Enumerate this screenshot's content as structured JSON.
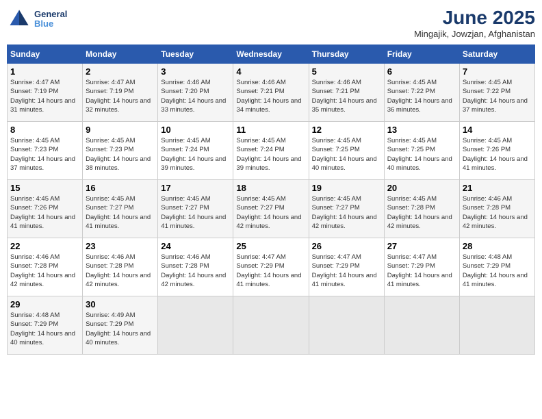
{
  "header": {
    "logo_line1": "General",
    "logo_line2": "Blue",
    "title": "June 2025",
    "subtitle": "Mingajik, Jowzjan, Afghanistan"
  },
  "calendar": {
    "days_of_week": [
      "Sunday",
      "Monday",
      "Tuesday",
      "Wednesday",
      "Thursday",
      "Friday",
      "Saturday"
    ],
    "weeks": [
      [
        null,
        {
          "day": "2",
          "sunrise": "4:47 AM",
          "sunset": "7:19 PM",
          "daylight": "14 hours and 32 minutes."
        },
        {
          "day": "3",
          "sunrise": "4:46 AM",
          "sunset": "7:20 PM",
          "daylight": "14 hours and 33 minutes."
        },
        {
          "day": "4",
          "sunrise": "4:46 AM",
          "sunset": "7:21 PM",
          "daylight": "14 hours and 34 minutes."
        },
        {
          "day": "5",
          "sunrise": "4:46 AM",
          "sunset": "7:21 PM",
          "daylight": "14 hours and 35 minutes."
        },
        {
          "day": "6",
          "sunrise": "4:45 AM",
          "sunset": "7:22 PM",
          "daylight": "14 hours and 36 minutes."
        },
        {
          "day": "7",
          "sunrise": "4:45 AM",
          "sunset": "7:22 PM",
          "daylight": "14 hours and 37 minutes."
        }
      ],
      [
        {
          "day": "1",
          "sunrise": "4:47 AM",
          "sunset": "7:19 PM",
          "daylight": "14 hours and 31 minutes."
        },
        {
          "day": "9",
          "sunrise": "4:45 AM",
          "sunset": "7:23 PM",
          "daylight": "14 hours and 38 minutes."
        },
        {
          "day": "10",
          "sunrise": "4:45 AM",
          "sunset": "7:24 PM",
          "daylight": "14 hours and 39 minutes."
        },
        {
          "day": "11",
          "sunrise": "4:45 AM",
          "sunset": "7:24 PM",
          "daylight": "14 hours and 39 minutes."
        },
        {
          "day": "12",
          "sunrise": "4:45 AM",
          "sunset": "7:25 PM",
          "daylight": "14 hours and 40 minutes."
        },
        {
          "day": "13",
          "sunrise": "4:45 AM",
          "sunset": "7:25 PM",
          "daylight": "14 hours and 40 minutes."
        },
        {
          "day": "14",
          "sunrise": "4:45 AM",
          "sunset": "7:26 PM",
          "daylight": "14 hours and 41 minutes."
        }
      ],
      [
        {
          "day": "8",
          "sunrise": "4:45 AM",
          "sunset": "7:23 PM",
          "daylight": "14 hours and 37 minutes."
        },
        {
          "day": "16",
          "sunrise": "4:45 AM",
          "sunset": "7:27 PM",
          "daylight": "14 hours and 41 minutes."
        },
        {
          "day": "17",
          "sunrise": "4:45 AM",
          "sunset": "7:27 PM",
          "daylight": "14 hours and 41 minutes."
        },
        {
          "day": "18",
          "sunrise": "4:45 AM",
          "sunset": "7:27 PM",
          "daylight": "14 hours and 42 minutes."
        },
        {
          "day": "19",
          "sunrise": "4:45 AM",
          "sunset": "7:27 PM",
          "daylight": "14 hours and 42 minutes."
        },
        {
          "day": "20",
          "sunrise": "4:45 AM",
          "sunset": "7:28 PM",
          "daylight": "14 hours and 42 minutes."
        },
        {
          "day": "21",
          "sunrise": "4:46 AM",
          "sunset": "7:28 PM",
          "daylight": "14 hours and 42 minutes."
        }
      ],
      [
        {
          "day": "15",
          "sunrise": "4:45 AM",
          "sunset": "7:26 PM",
          "daylight": "14 hours and 41 minutes."
        },
        {
          "day": "23",
          "sunrise": "4:46 AM",
          "sunset": "7:28 PM",
          "daylight": "14 hours and 42 minutes."
        },
        {
          "day": "24",
          "sunrise": "4:46 AM",
          "sunset": "7:28 PM",
          "daylight": "14 hours and 42 minutes."
        },
        {
          "day": "25",
          "sunrise": "4:47 AM",
          "sunset": "7:29 PM",
          "daylight": "14 hours and 41 minutes."
        },
        {
          "day": "26",
          "sunrise": "4:47 AM",
          "sunset": "7:29 PM",
          "daylight": "14 hours and 41 minutes."
        },
        {
          "day": "27",
          "sunrise": "4:47 AM",
          "sunset": "7:29 PM",
          "daylight": "14 hours and 41 minutes."
        },
        {
          "day": "28",
          "sunrise": "4:48 AM",
          "sunset": "7:29 PM",
          "daylight": "14 hours and 41 minutes."
        }
      ],
      [
        {
          "day": "22",
          "sunrise": "4:46 AM",
          "sunset": "7:28 PM",
          "daylight": "14 hours and 42 minutes."
        },
        {
          "day": "30",
          "sunrise": "4:49 AM",
          "sunset": "7:29 PM",
          "daylight": "14 hours and 40 minutes."
        },
        null,
        null,
        null,
        null,
        null
      ],
      [
        {
          "day": "29",
          "sunrise": "4:48 AM",
          "sunset": "7:29 PM",
          "daylight": "14 hours and 40 minutes."
        },
        null,
        null,
        null,
        null,
        null,
        null
      ]
    ]
  }
}
